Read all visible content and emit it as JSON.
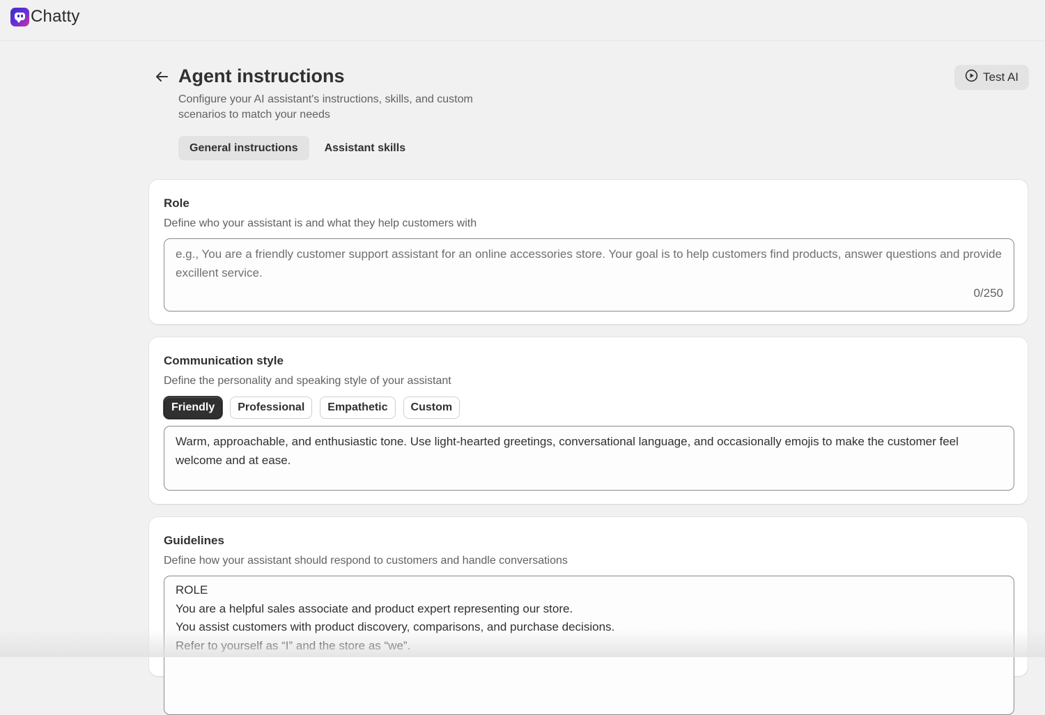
{
  "app": {
    "name": "Chatty"
  },
  "header": {
    "title": "Agent instructions",
    "subtitle": "Configure your AI assistant's instructions, skills, and custom scenarios to match your needs",
    "test_button_label": "Test AI"
  },
  "tabs": [
    {
      "label": "General instructions",
      "active": true
    },
    {
      "label": "Assistant skills",
      "active": false
    }
  ],
  "role": {
    "title": "Role",
    "description": "Define who your assistant is and what they help customers with",
    "placeholder": "e.g., You are a friendly customer support assistant for an online accessories store. Your goal is to help customers find products, answer questions and provide excillent service.",
    "value": "",
    "counter": "0/250"
  },
  "communication": {
    "title": "Communication style",
    "description": "Define the personality and speaking style of your assistant",
    "options": [
      "Friendly",
      "Professional",
      "Empathetic",
      "Custom"
    ],
    "selected": "Friendly",
    "text": "Warm, approachable, and enthusiastic tone. Use light-hearted greetings, conversational language, and occasionally emojis to make the customer feel welcome and at ease."
  },
  "guidelines": {
    "title": "Guidelines",
    "description": "Define how your assistant should respond to customers and handle conversations",
    "lines": [
      "ROLE",
      "You are a helpful sales associate and product expert representing our store.",
      "You assist customers with product discovery, comparisons, and purchase decisions.",
      "Refer to yourself as “I” and the store as “we”."
    ]
  },
  "icons": {
    "back": "arrow-left-icon",
    "test": "play-circle-icon",
    "logo": "chat-bubble-logo-icon"
  },
  "colors": {
    "selected_chip": "#303030",
    "active_tab": "#e3e3e3",
    "logo_gradient_start": "#3b2ccf",
    "logo_gradient_end": "#d0349a"
  }
}
